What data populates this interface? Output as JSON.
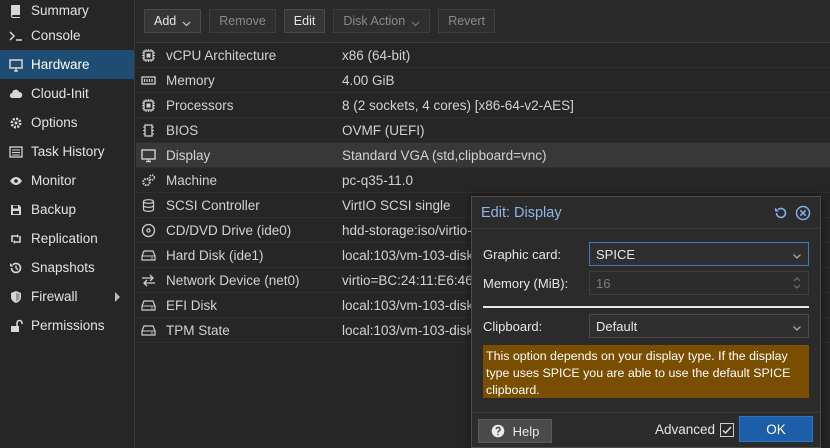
{
  "sidebar": {
    "items": [
      {
        "label": "Summary",
        "icon": "book-icon",
        "active": false
      },
      {
        "label": "Console",
        "icon": "terminal-icon",
        "active": false
      },
      {
        "label": "Hardware",
        "icon": "monitor-icon",
        "active": true
      },
      {
        "label": "Cloud-Init",
        "icon": "cloud-icon",
        "active": false
      },
      {
        "label": "Options",
        "icon": "gear-icon",
        "active": false
      },
      {
        "label": "Task History",
        "icon": "list-icon",
        "active": false
      },
      {
        "label": "Monitor",
        "icon": "eye-icon",
        "active": false
      },
      {
        "label": "Backup",
        "icon": "save-icon",
        "active": false
      },
      {
        "label": "Replication",
        "icon": "retweet-icon",
        "active": false
      },
      {
        "label": "Snapshots",
        "icon": "history-icon",
        "active": false
      },
      {
        "label": "Firewall",
        "icon": "shield-icon",
        "active": false
      },
      {
        "label": "Permissions",
        "icon": "unlock-icon",
        "active": false
      }
    ]
  },
  "toolbar": {
    "add": "Add",
    "remove": "Remove",
    "edit": "Edit",
    "disk_action": "Disk Action",
    "revert": "Revert"
  },
  "hardware": {
    "rows": [
      {
        "name": "vCPU Architecture",
        "value": "x86 (64-bit)",
        "icon": "cpu-icon"
      },
      {
        "name": "Memory",
        "value": "4.00 GiB",
        "icon": "memory-icon"
      },
      {
        "name": "Processors",
        "value": "8 (2 sockets, 4 cores) [x86-64-v2-AES]",
        "icon": "cpu-icon"
      },
      {
        "name": "BIOS",
        "value": "OVMF (UEFI)",
        "icon": "chip-icon"
      },
      {
        "name": "Display",
        "value": "Standard VGA (std,clipboard=vnc)",
        "icon": "desktop-icon"
      },
      {
        "name": "Machine",
        "value": "pc-q35-11.0",
        "icon": "cogs-icon"
      },
      {
        "name": "SCSI Controller",
        "value": "VirtIO SCSI single",
        "icon": "database-icon"
      },
      {
        "name": "CD/DVD Drive (ide0)",
        "value": "hdd-storage:iso/virtio-",
        "icon": "disc-icon"
      },
      {
        "name": "Hard Disk (ide1)",
        "value": "local:103/vm-103-disk",
        "icon": "hdd-icon"
      },
      {
        "name": "Network Device (net0)",
        "value": "virtio=BC:24:11:E6:46",
        "icon": "exchange-icon"
      },
      {
        "name": "EFI Disk",
        "value": "local:103/vm-103-disk",
        "icon": "hdd-icon"
      },
      {
        "name": "TPM State",
        "value": "local:103/vm-103-disk",
        "icon": "hdd-icon"
      }
    ]
  },
  "dialog": {
    "title": "Edit: Display",
    "graphic_card_label": "Graphic card:",
    "graphic_card_value": "SPICE",
    "memory_label": "Memory (MiB):",
    "memory_value": "16",
    "clipboard_label": "Clipboard:",
    "clipboard_value": "Default",
    "warning": "This option depends on your display type. If the display type uses SPICE you are able to use the default SPICE clipboard.",
    "help": "Help",
    "advanced": "Advanced",
    "ok": "OK"
  },
  "colors": {
    "accent": "#1e4c72",
    "dialog_title": "#8fb8e6",
    "warning_bg": "#7a4e00",
    "ok_button": "#1c5fa8"
  }
}
